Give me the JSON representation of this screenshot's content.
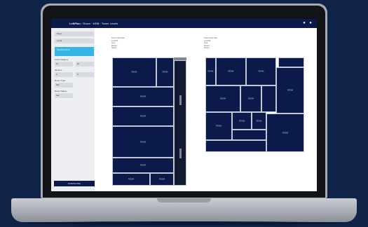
{
  "app": {
    "title_brand": "LeftPlan",
    "title_rest": " · Room · MRB · Tower Levels",
    "icons": [
      "bell-icon",
      "user-icon"
    ]
  },
  "sidebar": {
    "fields": [
      "Floor",
      "Level"
    ],
    "highlight": "Selected Area",
    "groups": [
      {
        "label": "Area Category",
        "values": [
          "Gr.",
          "Ni."
        ]
      },
      {
        "label": "Options",
        "values": [
          "2.",
          "4."
        ]
      },
      {
        "label": "Room Type",
        "values": [
          "Sel."
        ]
      },
      {
        "label": "Room Status",
        "values": [
          "Sel."
        ]
      }
    ],
    "button_label": "DOWNLOAD"
  },
  "plan_left": {
    "info": [
      "Tower Floor Plan",
      "Level 01",
      "Area",
      "Rooms",
      "Status"
    ],
    "labels": [
      "ROOM",
      "ROOM",
      "ROOM",
      "ROOM",
      "ROOM",
      "ROOM",
      "ROOM",
      "ROOM"
    ]
  },
  "plan_right": {
    "info": [
      "Tower Floor Plan",
      "Level 02",
      "Area",
      "Rooms",
      "Status"
    ],
    "labels": [
      "ROOM",
      "ROOM",
      "ROOM",
      "ROOM",
      "ROOM",
      "ROOM",
      "ROOM",
      "ROOM",
      "ROOM",
      "ROOM"
    ]
  }
}
